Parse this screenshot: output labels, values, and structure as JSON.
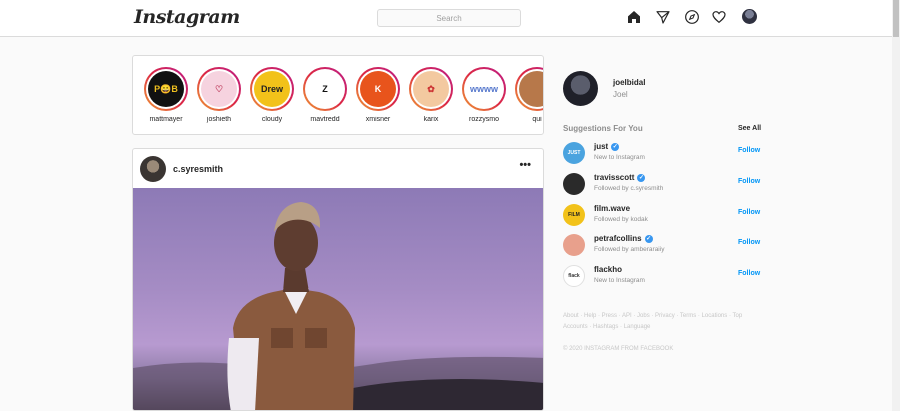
{
  "header": {
    "logo": "Instagram",
    "search_placeholder": "Search"
  },
  "stories": [
    {
      "name": "mattmayer",
      "avatar_text": "P😀B",
      "bg": "#111111",
      "fg": "#f0c020"
    },
    {
      "name": "joshieth",
      "avatar_text": "♡",
      "bg": "#f6d3df",
      "fg": "#c04060"
    },
    {
      "name": "cloudy",
      "avatar_text": "Drew",
      "bg": "#f2c21a",
      "fg": "#222222"
    },
    {
      "name": "mavtredd",
      "avatar_text": "Z",
      "bg": "#ffffff",
      "fg": "#111111"
    },
    {
      "name": "xmisner",
      "avatar_text": "K",
      "bg": "#e8541c",
      "fg": "#ffffff"
    },
    {
      "name": "karix",
      "avatar_text": "✿",
      "bg": "#f3c9a0",
      "fg": "#cc3333"
    },
    {
      "name": "rozzysmo",
      "avatar_text": "wwww",
      "bg": "#ffffff",
      "fg": "#5577cc"
    },
    {
      "name": "qui",
      "avatar_text": "",
      "bg": "#b7784a",
      "fg": "#ffffff"
    }
  ],
  "post": {
    "username": "c.syresmith",
    "more": "•••"
  },
  "sidebar": {
    "username": "joelbidal",
    "name": "Joel",
    "suggestions_title": "Suggestions For You",
    "see_all": "See All",
    "suggestions": [
      {
        "username": "just",
        "subtitle": "New to Instagram",
        "verified": true,
        "avatar_text": "JUST",
        "bg": "#4aa3df",
        "fg": "#ffffff",
        "follow": "Follow"
      },
      {
        "username": "travisscott",
        "subtitle": "Followed by c.syresmith",
        "verified": true,
        "avatar_text": "",
        "bg": "#2a2a2a",
        "fg": "#ffffff",
        "follow": "Follow"
      },
      {
        "username": "film.wave",
        "subtitle": "Followed by kodak",
        "verified": false,
        "avatar_text": "FILM",
        "bg": "#f2c21a",
        "fg": "#222222",
        "follow": "Follow"
      },
      {
        "username": "petrafcollins",
        "subtitle": "Followed by amberaraiiy",
        "verified": true,
        "avatar_text": "",
        "bg": "#e8a08c",
        "fg": "#ffffff",
        "follow": "Follow"
      },
      {
        "username": "flackho",
        "subtitle": "New to Instagram",
        "verified": false,
        "avatar_text": "flack",
        "bg": "#ffffff",
        "fg": "#333333",
        "follow": "Follow"
      }
    ],
    "footer_links": "About · Help · Press · API · Jobs · Privacy · Terms · Locations · Top Accounts · Hashtags · Language",
    "copyright": "© 2020 INSTAGRAM FROM FACEBOOK"
  },
  "icons": {
    "home": "home-icon",
    "direct": "paper-plane-icon",
    "explore": "compass-icon",
    "activity": "heart-icon"
  }
}
